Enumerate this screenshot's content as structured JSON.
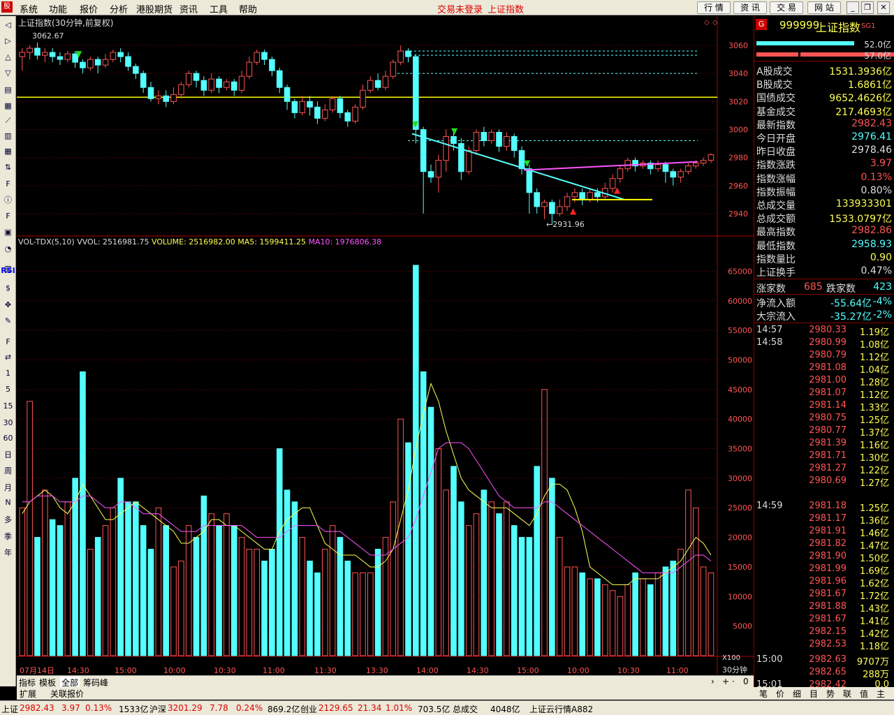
{
  "colors": {
    "up": "#ff5555",
    "down": "#54ffff",
    "ma5": "#ffff55",
    "ma10": "#ff55ff",
    "grid": "#800000",
    "yellow_line": "#ffff00"
  },
  "menu": {
    "items": [
      "系统",
      "功能",
      "报价",
      "分析",
      "港股期货",
      "资讯",
      "工具",
      "帮助"
    ],
    "status_left": "交易未登录",
    "status_right": "上证指数",
    "buttons": [
      "行 情",
      "资 讯",
      "交 易",
      "网 站"
    ]
  },
  "left_toolbar": {
    "labels": [
      "RSI",
      "1",
      "5",
      "15",
      "30",
      "60",
      "日",
      "周",
      "月",
      "N",
      "多",
      "季",
      "年"
    ],
    "icons": [
      "back-icon",
      "forward-icon",
      "up-icon",
      "down-icon",
      "quote-icon",
      "table-icon",
      "line-chart-icon",
      "candle-icon",
      "grid-icon",
      "sort-icon",
      "f10-icon",
      "info-icon",
      "fundamental-icon",
      "file-icon",
      "pie-icon",
      "volume-icon",
      "dollar-icon",
      "cross-icon",
      "pen-icon",
      "f5-icon",
      "swap-icon"
    ]
  },
  "chart": {
    "title": "上证指数(30分钟,前复权)",
    "high_label": "3062.67",
    "low_label": "←2931.96",
    "price_ticks": [
      "3060",
      "3040",
      "3020",
      "3000",
      "2980",
      "2960",
      "2940"
    ],
    "vol_title": "VOL-TDX(5,10)",
    "vol_items": [
      {
        "label": "VVOL: 2516981.75",
        "color": "#dddddd"
      },
      {
        "label": "VOLUME: 2516982.00",
        "color": "#ffff55"
      },
      {
        "label": "MA5: 1599411.25",
        "color": "#ffff55"
      },
      {
        "label": "MA10: 1976806.38",
        "color": "#ff55ff"
      }
    ],
    "vol_ticks": [
      "65000",
      "60000",
      "55000",
      "50000",
      "45000",
      "40000",
      "35000",
      "30000",
      "25000",
      "20000",
      "15000",
      "10000",
      "5000"
    ],
    "x_labels": [
      "07月14日",
      "14:30",
      "15:00",
      "10:00",
      "10:30",
      "11:00",
      "11:30",
      "13:30",
      "14:00",
      "14:30",
      "15:00",
      "10:00",
      "10:30",
      "11:00"
    ],
    "x_badge": "X100",
    "period": "30分钟"
  },
  "chart_data": {
    "type": "candlestick",
    "candles": [
      [
        3052,
        3055,
        3042,
        3058
      ],
      [
        3055,
        3058,
        3050,
        3060
      ],
      [
        3058,
        3053,
        3050,
        3062
      ],
      [
        3053,
        3055,
        3048,
        3058
      ],
      [
        3055,
        3052,
        3048,
        3058
      ],
      [
        3052,
        3050,
        3046,
        3055
      ],
      [
        3050,
        3054,
        3048,
        3056
      ],
      [
        3054,
        3048,
        3044,
        3056
      ],
      [
        3048,
        3044,
        3040,
        3050
      ],
      [
        3044,
        3050,
        3042,
        3052
      ],
      [
        3050,
        3046,
        3040,
        3052
      ],
      [
        3046,
        3050,
        3044,
        3054
      ],
      [
        3050,
        3055,
        3048,
        3057
      ],
      [
        3055,
        3052,
        3048,
        3058
      ],
      [
        3052,
        3045,
        3042,
        3055
      ],
      [
        3045,
        3040,
        3036,
        3047
      ],
      [
        3040,
        3030,
        3026,
        3042
      ],
      [
        3030,
        3022,
        3020,
        3034
      ],
      [
        3022,
        3024,
        3018,
        3028
      ],
      [
        3024,
        3020,
        3016,
        3028
      ],
      [
        3020,
        3025,
        3018,
        3030
      ],
      [
        3025,
        3032,
        3022,
        3034
      ],
      [
        3032,
        3040,
        3030,
        3042
      ],
      [
        3040,
        3035,
        3030,
        3042
      ],
      [
        3035,
        3028,
        3024,
        3038
      ],
      [
        3028,
        3036,
        3026,
        3040
      ],
      [
        3036,
        3030,
        3026,
        3038
      ],
      [
        3030,
        3034,
        3028,
        3036
      ],
      [
        3034,
        3028,
        3024,
        3036
      ],
      [
        3028,
        3038,
        3026,
        3042
      ],
      [
        3038,
        3048,
        3036,
        3052
      ],
      [
        3048,
        3055,
        3046,
        3057
      ],
      [
        3055,
        3050,
        3046,
        3057
      ],
      [
        3050,
        3042,
        3038,
        3052
      ],
      [
        3042,
        3030,
        3026,
        3044
      ],
      [
        3030,
        3020,
        3014,
        3032
      ],
      [
        3020,
        3012,
        3008,
        3022
      ],
      [
        3012,
        3020,
        3010,
        3024
      ],
      [
        3020,
        3016,
        3010,
        3024
      ],
      [
        3016,
        3008,
        3004,
        3020
      ],
      [
        3008,
        3014,
        3006,
        3018
      ],
      [
        3014,
        3022,
        3012,
        3024
      ],
      [
        3022,
        3012,
        3008,
        3024
      ],
      [
        3012,
        3006,
        3002,
        3014
      ],
      [
        3006,
        3016,
        3004,
        3018
      ],
      [
        3016,
        3028,
        3014,
        3032
      ],
      [
        3028,
        3035,
        3026,
        3038
      ],
      [
        3035,
        3030,
        3028,
        3040
      ],
      [
        3030,
        3038,
        3028,
        3042
      ],
      [
        3038,
        3048,
        3036,
        3050
      ],
      [
        3048,
        3056,
        3046,
        3060
      ],
      [
        3056,
        3052,
        3048,
        3058
      ],
      [
        3052,
        3000,
        2990,
        3054
      ],
      [
        3000,
        2970,
        2940,
        3002
      ],
      [
        2970,
        2966,
        2962,
        2975
      ],
      [
        2966,
        2978,
        2955,
        2982
      ],
      [
        2978,
        2995,
        2970,
        3000
      ],
      [
        2995,
        2990,
        2985,
        2998
      ],
      [
        2990,
        2970,
        2964,
        2994
      ],
      [
        2970,
        2985,
        2968,
        2988
      ],
      [
        2985,
        2998,
        2982,
        3000
      ],
      [
        2998,
        2992,
        2988,
        3002
      ],
      [
        2992,
        2998,
        2990,
        3000
      ],
      [
        2998,
        2988,
        2984,
        3000
      ],
      [
        2988,
        2995,
        2985,
        2998
      ],
      [
        2995,
        2985,
        2980,
        2997
      ],
      [
        2985,
        2972,
        2968,
        2988
      ],
      [
        2972,
        2955,
        2940,
        2975
      ],
      [
        2955,
        2945,
        2940,
        2958
      ],
      [
        2945,
        2948,
        2936,
        2950
      ],
      [
        2948,
        2940,
        2932,
        2950
      ],
      [
        2940,
        2945,
        2938,
        2950
      ],
      [
        2945,
        2952,
        2942,
        2955
      ],
      [
        2952,
        2955,
        2948,
        2958
      ],
      [
        2955,
        2950,
        2946,
        2958
      ],
      [
        2950,
        2955,
        2948,
        2958
      ],
      [
        2955,
        2952,
        2948,
        2958
      ],
      [
        2952,
        2958,
        2950,
        2962
      ],
      [
        2958,
        2965,
        2955,
        2968
      ],
      [
        2965,
        2972,
        2962,
        2975
      ],
      [
        2972,
        2978,
        2970,
        2980
      ],
      [
        2978,
        2974,
        2970,
        2980
      ],
      [
        2974,
        2976,
        2972,
        2978
      ],
      [
        2976,
        2972,
        2968,
        2978
      ],
      [
        2972,
        2975,
        2970,
        2978
      ],
      [
        2975,
        2970,
        2962,
        2977
      ],
      [
        2970,
        2966,
        2960,
        2972
      ],
      [
        2966,
        2970,
        2962,
        2972
      ],
      [
        2970,
        2974,
        2968,
        2976
      ],
      [
        2974,
        2976,
        2972,
        2978
      ],
      [
        2976,
        2978,
        2974,
        2980
      ],
      [
        2978,
        2982,
        2976,
        2983
      ]
    ],
    "volumes": [
      25,
      43,
      20,
      28,
      23,
      22,
      26,
      30,
      48,
      18,
      20,
      22,
      25,
      30,
      26,
      26,
      22,
      18,
      25,
      22,
      15,
      16,
      22,
      20,
      27,
      24,
      22,
      24,
      22,
      20,
      18,
      18,
      16,
      18,
      35,
      28,
      26,
      20,
      16,
      14,
      18,
      22,
      20,
      16,
      14,
      14,
      14,
      18,
      20,
      26,
      40,
      36,
      66,
      48,
      42,
      35,
      28,
      32,
      26,
      22,
      24,
      28,
      26,
      24,
      26,
      22,
      20,
      20,
      32,
      45,
      30,
      20,
      15,
      15,
      14,
      13,
      13,
      12,
      11,
      10,
      12,
      14,
      13,
      12,
      14,
      15,
      16,
      18,
      28,
      25,
      15,
      14
    ],
    "ma5": [
      24,
      26,
      27,
      28,
      27,
      25,
      24,
      26,
      29,
      27,
      25,
      23,
      23,
      24,
      25,
      26,
      25,
      24,
      23,
      22,
      21,
      19,
      19,
      20,
      21,
      23,
      23,
      22,
      22,
      21,
      20,
      19,
      18,
      18,
      21,
      23,
      24,
      25,
      25,
      22,
      19,
      18,
      17,
      17,
      17,
      16,
      15,
      15,
      16,
      18,
      23,
      28,
      35,
      41,
      46,
      43,
      38,
      34,
      30,
      28,
      27,
      26,
      25,
      25,
      25,
      24,
      23,
      22,
      24,
      27,
      29,
      29,
      28,
      25,
      21,
      15,
      14,
      13,
      12,
      12,
      12,
      13,
      13,
      13,
      13,
      14,
      15,
      16,
      18,
      20,
      19,
      17
    ],
    "ma10": [
      26,
      26,
      27,
      27,
      27,
      26,
      26,
      26,
      27,
      27,
      26,
      25,
      25,
      26,
      26,
      25,
      24,
      24,
      24,
      23,
      22,
      21,
      21,
      21,
      22,
      22,
      22,
      22,
      22,
      22,
      21,
      20,
      20,
      20,
      20,
      21,
      22,
      22,
      22,
      22,
      21,
      21,
      21,
      20,
      19,
      18,
      17,
      17,
      17,
      18,
      19,
      20,
      23,
      27,
      31,
      35,
      36,
      36,
      36,
      35,
      33,
      31,
      29,
      27,
      26,
      25,
      25,
      25,
      25,
      26,
      26,
      25,
      24,
      23,
      22,
      21,
      20,
      19,
      18,
      17,
      16,
      15,
      14,
      14,
      14,
      14,
      14,
      15,
      16,
      17,
      17,
      16
    ],
    "ymin": 2925,
    "ymax": 3065,
    "vmax": 68
  },
  "quote": {
    "code": "999999",
    "name": "上证指数",
    "suffix": "SG1",
    "bar1": "52.0亿",
    "bar2": "57.0亿",
    "rows": [
      {
        "k": "A股成交",
        "v": "1531.3936亿",
        "c": "#ffff55"
      },
      {
        "k": "B股成交",
        "v": "1.6861亿",
        "c": "#ffff55"
      },
      {
        "k": "国债成交",
        "v": "9652.4626亿",
        "c": "#ffff55"
      },
      {
        "k": "基金成交",
        "v": "217.4693亿",
        "c": "#ffff55"
      },
      {
        "k": "最新指数",
        "v": "2982.43",
        "c": "#ff5555"
      },
      {
        "k": "今日开盘",
        "v": "2976.41",
        "c": "#54ffff"
      },
      {
        "k": "昨日收盘",
        "v": "2978.46",
        "c": "#dddddd"
      },
      {
        "k": "指数涨跌",
        "v": "3.97",
        "c": "#ff5555"
      },
      {
        "k": "指数涨幅",
        "v": "0.13%",
        "c": "#ff5555"
      },
      {
        "k": "指数振幅",
        "v": "0.80%",
        "c": "#dddddd"
      },
      {
        "k": "总成交量",
        "v": "133933301",
        "c": "#ffff55"
      },
      {
        "k": "总成交额",
        "v": "1533.0797亿",
        "c": "#ffff55"
      },
      {
        "k": "最高指数",
        "v": "2982.86",
        "c": "#ff5555"
      },
      {
        "k": "最低指数",
        "v": "2958.93",
        "c": "#54ffff"
      },
      {
        "k": "指数量比",
        "v": "0.90",
        "c": "#ffff55"
      },
      {
        "k": "上证换手",
        "v": "0.47%",
        "c": "#dddddd"
      }
    ],
    "up_label": "涨家数",
    "up": "685",
    "down_label": "跌家数",
    "down": "423",
    "net_label": "净流入额",
    "net": "-55.64亿",
    "net_pct": "-4%",
    "big_label": "大宗流入",
    "big": "-35.27亿",
    "big_pct": "-2%"
  },
  "ticks": [
    {
      "t": "14:57",
      "p": "2980.33",
      "q": "1.19亿"
    },
    {
      "t": "14:58",
      "p": "2980.99",
      "q": "1.08亿"
    },
    {
      "t": "",
      "p": "2980.79",
      "q": "1.12亿"
    },
    {
      "t": "",
      "p": "2981.08",
      "q": "1.04亿"
    },
    {
      "t": "",
      "p": "2981.00",
      "q": "1.28亿"
    },
    {
      "t": "",
      "p": "2981.07",
      "q": "1.12亿"
    },
    {
      "t": "",
      "p": "2981.14",
      "q": "1.33亿"
    },
    {
      "t": "",
      "p": "2980.75",
      "q": "1.25亿"
    },
    {
      "t": "",
      "p": "2980.77",
      "q": "1.37亿"
    },
    {
      "t": "",
      "p": "2981.39",
      "q": "1.16亿"
    },
    {
      "t": "",
      "p": "2981.71",
      "q": "1.30亿"
    },
    {
      "t": "",
      "p": "2981.27",
      "q": "1.22亿"
    },
    {
      "t": "",
      "p": "2980.69",
      "q": "1.27亿"
    },
    {
      "t": "14:59",
      "p": "2981.18",
      "q": "1.25亿"
    },
    {
      "t": "",
      "p": "2981.17",
      "q": "1.36亿"
    },
    {
      "t": "",
      "p": "2981.91",
      "q": "1.46亿"
    },
    {
      "t": "",
      "p": "2981.82",
      "q": "1.47亿"
    },
    {
      "t": "",
      "p": "2981.90",
      "q": "1.50亿"
    },
    {
      "t": "",
      "p": "2981.99",
      "q": "1.69亿"
    },
    {
      "t": "",
      "p": "2981.96",
      "q": "1.62亿"
    },
    {
      "t": "",
      "p": "2981.67",
      "q": "1.72亿"
    },
    {
      "t": "",
      "p": "2981.88",
      "q": "1.43亿"
    },
    {
      "t": "",
      "p": "2981.67",
      "q": "1.41亿"
    },
    {
      "t": "",
      "p": "2982.15",
      "q": "1.42亿"
    },
    {
      "t": "",
      "p": "2982.53",
      "q": "1.18亿"
    },
    {
      "t": "15:00",
      "p": "2982.63",
      "q": "9707万"
    },
    {
      "t": "",
      "p": "2982.65",
      "q": "288万"
    },
    {
      "t": "15:01",
      "p": "2982.42",
      "q": "0.0"
    }
  ],
  "tabs": {
    "bottom": [
      "指标",
      "模板",
      "全部",
      "筹码峰"
    ],
    "bottom2": [
      "扩展",
      "关联报价"
    ],
    "right": [
      "笔",
      "价",
      "细",
      "目",
      "势",
      "联",
      "值",
      "主"
    ]
  },
  "status": {
    "items": [
      {
        "text": "上证",
        "c": "#000"
      },
      {
        "text": "2982.43",
        "c": "#d00"
      },
      {
        "text": "3.97",
        "c": "#d00"
      },
      {
        "text": "0.13%",
        "c": "#d00"
      },
      {
        "text": "1533亿",
        "c": "#000"
      },
      {
        "text": "沪深",
        "c": "#000"
      },
      {
        "text": "3201.29",
        "c": "#d00"
      },
      {
        "text": "7.78",
        "c": "#d00"
      },
      {
        "text": "0.24%",
        "c": "#d00"
      },
      {
        "text": "869.2亿",
        "c": "#000"
      },
      {
        "text": "创业",
        "c": "#000"
      },
      {
        "text": "2129.65",
        "c": "#d00"
      },
      {
        "text": "21.34",
        "c": "#d00"
      },
      {
        "text": "1.01%",
        "c": "#d00"
      },
      {
        "text": "703.5亿",
        "c": "#000"
      },
      {
        "text": "总成交",
        "c": "#000"
      },
      {
        "text": "4048亿",
        "c": "#000"
      },
      {
        "text": "上证云行情A882",
        "c": "#000"
      }
    ]
  }
}
